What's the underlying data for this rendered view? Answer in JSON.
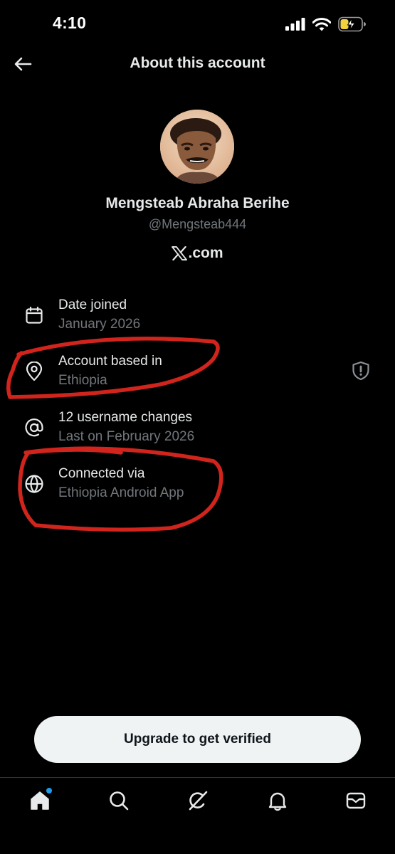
{
  "status_bar": {
    "time": "4:10"
  },
  "header": {
    "title": "About this account"
  },
  "profile": {
    "name": "Mengsteab Abraha Berihe",
    "handle": "@Mengsteab444",
    "platform": ".com"
  },
  "info": [
    {
      "icon": "calendar-icon",
      "label": "Date joined",
      "value": "January 2026"
    },
    {
      "icon": "location-pin-icon",
      "label": "Account based in",
      "value": "Ethiopia"
    },
    {
      "icon": "at-sign-icon",
      "label": "12 username changes",
      "value": "Last on February 2026"
    },
    {
      "icon": "globe-icon",
      "label": "Connected via",
      "value": "Ethiopia Android App"
    }
  ],
  "cta": {
    "label": "Upgrade to get verified"
  },
  "tabs": [
    "home-icon",
    "search-icon",
    "grok-icon",
    "bell-icon",
    "mail-icon"
  ],
  "colors": {
    "annotation": "#d0241c",
    "secondary_text": "#71767b",
    "accent_blue": "#1d9bf0"
  }
}
